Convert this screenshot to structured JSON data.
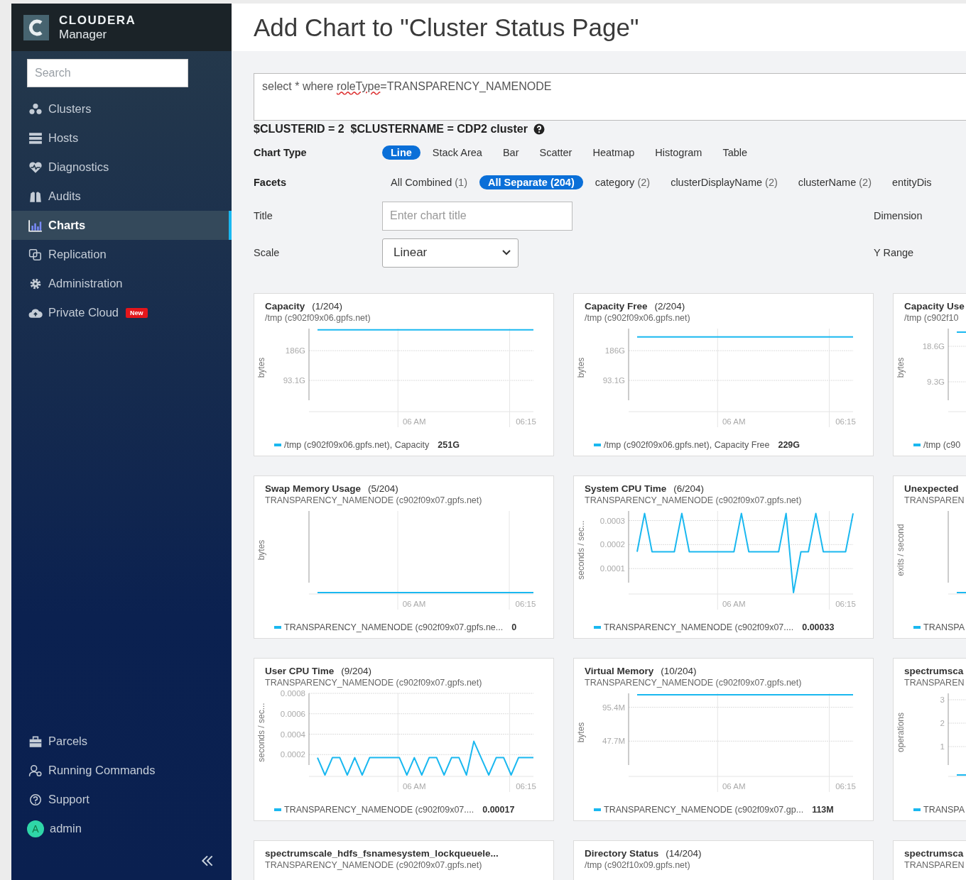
{
  "sidebar": {
    "brand": {
      "name": "CLOUDERA",
      "product": "Manager"
    },
    "search": {
      "placeholder": "Search"
    },
    "items": [
      {
        "label": "Clusters",
        "kind": "clusters",
        "selected": false
      },
      {
        "label": "Hosts",
        "kind": "hosts",
        "selected": false
      },
      {
        "label": "Diagnostics",
        "kind": "diagnostics",
        "selected": false
      },
      {
        "label": "Audits",
        "kind": "audits",
        "selected": false
      },
      {
        "label": "Charts",
        "kind": "charts",
        "selected": true
      },
      {
        "label": "Replication",
        "kind": "replication",
        "selected": false
      },
      {
        "label": "Administration",
        "kind": "administration",
        "selected": false
      },
      {
        "label": "Private Cloud",
        "kind": "cloud",
        "selected": false,
        "badge": "New"
      }
    ],
    "bottom_items": [
      {
        "label": "Parcels",
        "kind": "parcels",
        "selected": false
      },
      {
        "label": "Running Commands",
        "kind": "commands",
        "selected": false
      },
      {
        "label": "Support",
        "kind": "support",
        "selected": false
      }
    ],
    "user": {
      "initial": "A",
      "name": "admin"
    }
  },
  "page": {
    "title": "Add Chart to \"Cluster Status Page\""
  },
  "query": {
    "parts": [
      {
        "text": "select * where ",
        "misspelled": false
      },
      {
        "text": "roleType",
        "misspelled": true
      },
      {
        "text": "=TRANSPARENCY_NAMENODE",
        "misspelled": false
      }
    ]
  },
  "variables": "$CLUSTERID = 2  $CLUSTERNAME = CDP2 cluster",
  "chart_type": {
    "label": "Chart Type",
    "options": [
      {
        "label": "Line",
        "selected": true
      },
      {
        "label": "Stack Area",
        "selected": false
      },
      {
        "label": "Bar",
        "selected": false
      },
      {
        "label": "Scatter",
        "selected": false
      },
      {
        "label": "Heatmap",
        "selected": false
      },
      {
        "label": "Histogram",
        "selected": false
      },
      {
        "label": "Table",
        "selected": false
      }
    ]
  },
  "facets": {
    "label": "Facets",
    "options": [
      {
        "label": "All Combined",
        "count": "(1)",
        "selected": false
      },
      {
        "label": "All Separate",
        "count": "(204)",
        "selected": true
      },
      {
        "label": "category",
        "count": "(2)",
        "selected": false
      },
      {
        "label": "clusterDisplayName",
        "count": "(2)",
        "selected": false
      },
      {
        "label": "clusterName",
        "count": "(2)",
        "selected": false
      },
      {
        "label": "entityDis",
        "selected": false
      }
    ]
  },
  "title_field": {
    "label": "Title",
    "placeholder": "Enter chart title"
  },
  "scale": {
    "label": "Scale",
    "value": "Linear"
  },
  "dimension": {
    "label": "Dimension"
  },
  "y_range": {
    "label": "Y Range"
  },
  "charts": [
    {
      "title": "Capacity",
      "count": "(1/204)",
      "subtitle": "/tmp (c902f09x06.gpfs.net)",
      "legend_value": "251G",
      "chart_data": {
        "type": "line",
        "ylabel": "bytes",
        "grid": true,
        "ylim": [
          0,
          255
        ],
        "yticks": [
          {
            "value": 93.1,
            "label": "93.1G"
          },
          {
            "value": 186,
            "label": "186G"
          }
        ],
        "categories": [
          null,
          null,
          null,
          null,
          null,
          null,
          null,
          null,
          null,
          null,
          null,
          null,
          null,
          "06 AM",
          null,
          null,
          null,
          null,
          null,
          null,
          null,
          null,
          null,
          null,
          null,
          null,
          null,
          null,
          "06:15",
          null
        ],
        "series": [
          {
            "name": "/tmp (c902f09x06.gpfs.net), Capacity",
            "color": "#1ab8f0",
            "values": [
              251,
              251,
              251,
              251,
              251,
              251,
              251,
              251,
              251,
              251,
              251,
              251,
              251,
              251,
              251,
              251,
              251,
              251,
              251,
              251,
              251,
              251,
              251,
              251,
              251,
              251,
              251,
              251,
              251,
              251
            ]
          }
        ]
      }
    },
    {
      "title": "Capacity Free",
      "count": "(2/204)",
      "subtitle": "/tmp (c902f09x06.gpfs.net)",
      "legend_value": "229G",
      "chart_data": {
        "type": "line",
        "ylabel": "bytes",
        "grid": true,
        "ylim": [
          0,
          255
        ],
        "yticks": [
          {
            "value": 93.1,
            "label": "93.1G"
          },
          {
            "value": 186,
            "label": "186G"
          }
        ],
        "categories": [
          null,
          null,
          null,
          null,
          null,
          null,
          null,
          null,
          null,
          null,
          null,
          null,
          null,
          "06 AM",
          null,
          null,
          null,
          null,
          null,
          null,
          null,
          null,
          null,
          null,
          null,
          null,
          null,
          null,
          "06:15",
          null
        ],
        "series": [
          {
            "name": "/tmp (c902f09x06.gpfs.net), Capacity Free",
            "color": "#1ab8f0",
            "values": [
              229,
              229,
              229,
              229,
              229,
              229,
              229,
              229,
              229,
              229,
              229,
              229,
              229,
              229,
              229,
              229,
              229,
              229,
              229,
              229,
              229,
              229,
              229,
              229,
              229,
              229,
              229,
              229,
              229,
              229
            ]
          }
        ]
      }
    },
    {
      "title": "Capacity Use",
      "subtitle": "/tmp (c902f10",
      "partial": {
        "ylabel": "bytes",
        "ticks": [
          "18.6G",
          "9.3G"
        ],
        "high": true,
        "legend": "/tmp (c90"
      }
    },
    {
      "title": "Swap Memory Usage",
      "count": "(5/204)",
      "subtitle": "TRANSPARENCY_NAMENODE (c902f09x07.gpfs.net)",
      "partial": {
        "ylabel": "bytes",
        "xlabels": [
          "06 AM",
          "06:15"
        ],
        "high": false,
        "legend": "TRANSPARENCY_NAMENODE (c902f09x07.gpfs.ne...",
        "legend_value": "0"
      }
    },
    {
      "title": "System CPU Time",
      "count": "(6/204)",
      "subtitle": "TRANSPARENCY_NAMENODE (c902f09x07.gpfs.net)",
      "legend_value": "0.00033",
      "chart_data": {
        "type": "line",
        "ylabel": "seconds / sec...",
        "grid": true,
        "ylim": [
          0,
          0.00034
        ],
        "yticks": [
          {
            "value": 0.0001,
            "label": "0.0001"
          },
          {
            "value": 0.0002,
            "label": "0.0002"
          },
          {
            "value": 0.0003,
            "label": "0.0003"
          }
        ],
        "categories": [
          null,
          null,
          null,
          null,
          null,
          null,
          null,
          null,
          null,
          null,
          null,
          null,
          null,
          "06 AM",
          null,
          null,
          null,
          null,
          null,
          null,
          null,
          null,
          null,
          null,
          null,
          null,
          null,
          null,
          "06:15",
          null
        ],
        "series": [
          {
            "name": "TRANSPARENCY_NAMENODE (c902f09x07....",
            "color": "#1ab8f0",
            "values": [
              0.00017,
              0.00033,
              0.00017,
              0.00017,
              0.00017,
              0.00017,
              0.00033,
              0.00017,
              0.00017,
              0.00017,
              0.00017,
              0.00017,
              0.00017,
              0.00017,
              0.00033,
              0.00017,
              0.00017,
              0.00017,
              0.00017,
              0.00017,
              0.00033,
              0,
              0.00017,
              0.00017,
              0.00033,
              0.00017,
              0.00017,
              0.00017,
              0.00017,
              0.00033
            ]
          }
        ]
      }
    },
    {
      "title": "Unexpected",
      "subtitle": "TRANSPAREN",
      "partial": {
        "ylabel": "exits / second",
        "high": false,
        "legend": "TRANSPA"
      }
    },
    {
      "title": "User CPU Time",
      "count": "(9/204)",
      "subtitle": "TRANSPARENCY_NAMENODE (c902f09x07.gpfs.net)",
      "legend_value": "0.00017",
      "chart_data": {
        "type": "line",
        "ylabel": "seconds / sec...",
        "grid": true,
        "ylim": [
          0,
          0.0008
        ],
        "yticks": [
          {
            "value": 0.0002,
            "label": "0.0002"
          },
          {
            "value": 0.0004,
            "label": "0.0004"
          },
          {
            "value": 0.0006,
            "label": "0.0006"
          },
          {
            "value": 0.0008,
            "label": "0.0008"
          }
        ],
        "categories": [
          null,
          null,
          null,
          null,
          null,
          null,
          null,
          null,
          null,
          null,
          null,
          null,
          null,
          "06 AM",
          null,
          null,
          null,
          null,
          null,
          null,
          null,
          null,
          null,
          null,
          null,
          null,
          null,
          null,
          "06:15",
          null
        ],
        "series": [
          {
            "name": "TRANSPARENCY_NAMENODE (c902f09x07....",
            "color": "#1ab8f0",
            "values": [
              0.00017,
              0,
              0.00017,
              0.00017,
              0,
              0.00017,
              0,
              0.00017,
              0.00017,
              0.00017,
              0.00017,
              0.00017,
              0,
              0.00017,
              0,
              0.00017,
              0.00017,
              0,
              0.00017,
              0.00017,
              0,
              0.00033,
              0.000165,
              0,
              0.00017,
              0.00017,
              0,
              0.00017,
              0.00017,
              0.00017
            ]
          }
        ]
      }
    },
    {
      "title": "Virtual Memory",
      "count": "(10/204)",
      "subtitle": "TRANSPARENCY_NAMENODE (c902f09x07.gpfs.net)",
      "legend_value": "113M",
      "chart_data": {
        "type": "line",
        "ylabel": "bytes",
        "grid": true,
        "ylim": [
          0,
          115
        ],
        "yticks": [
          {
            "value": 47.7,
            "label": "47.7M"
          },
          {
            "value": 95.4,
            "label": "95.4M"
          }
        ],
        "categories": [
          null,
          null,
          null,
          null,
          null,
          null,
          null,
          null,
          null,
          null,
          null,
          null,
          null,
          "06 AM",
          null,
          null,
          null,
          null,
          null,
          null,
          null,
          null,
          null,
          null,
          null,
          null,
          null,
          null,
          "06:15",
          null
        ],
        "series": [
          {
            "name": "TRANSPARENCY_NAMENODE (c902f09x07.gp...",
            "color": "#1ab8f0",
            "values": [
              113,
              113,
              113,
              113,
              113,
              113,
              113,
              113,
              113,
              113,
              113,
              113,
              113,
              113,
              113,
              113,
              113,
              113,
              113,
              113,
              113,
              113,
              113,
              113,
              113,
              113,
              113,
              113,
              113,
              113
            ]
          }
        ]
      }
    },
    {
      "title": "spectrumsca",
      "subtitle": "TRANSPAREN",
      "partial": {
        "ylabel": "operations",
        "ticks": [
          "3",
          "2",
          "1"
        ],
        "high": false,
        "legend": "TRANSPA"
      }
    },
    {
      "title": "spectrumscale_hdfs_fsnamesystem_lockqueuele...",
      "subtitle": "TRANSPARENCY_NAMENODE (c902f09x07.gpfs.net)"
    },
    {
      "title": "Directory Status",
      "count": "(14/204)",
      "subtitle": "/tmp (c902f10x09.gpfs.net)"
    },
    {
      "title": "spectrumsca",
      "subtitle": "TRANSPAREN"
    }
  ]
}
